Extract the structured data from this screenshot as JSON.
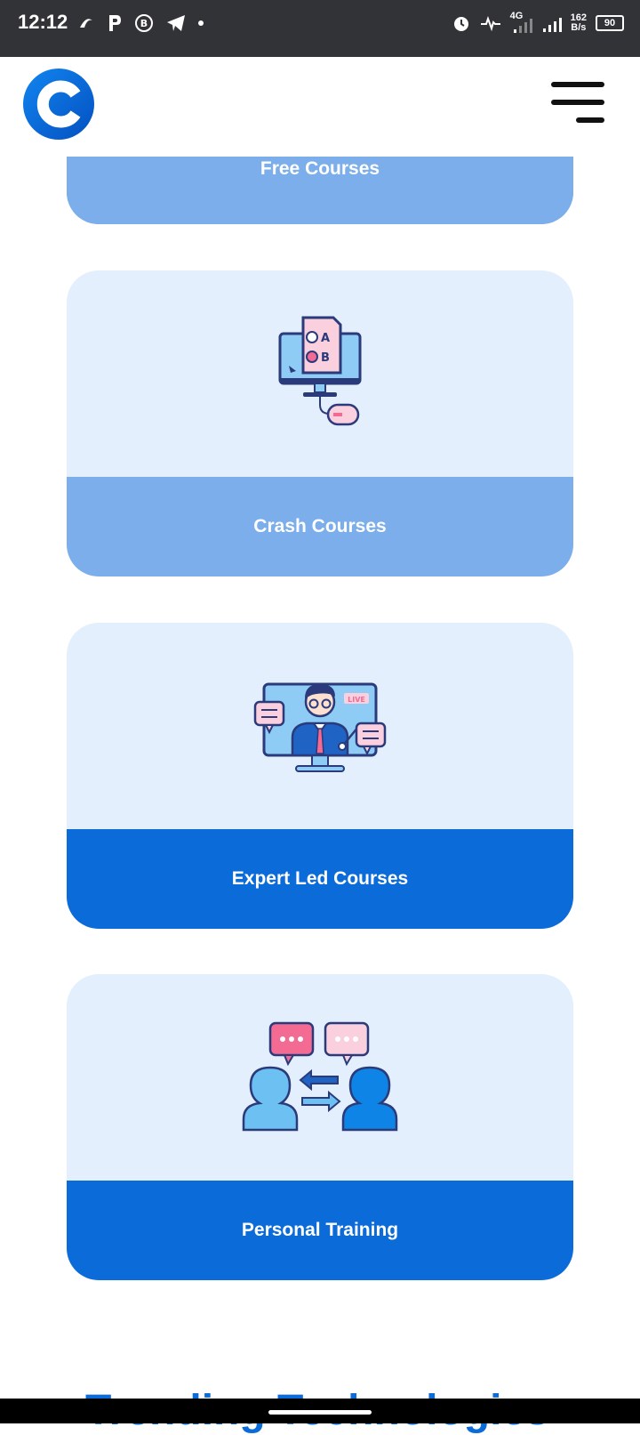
{
  "status_bar": {
    "time": "12:12",
    "network_type": "4G",
    "net_speed_value": "162",
    "net_speed_unit": "B/s",
    "battery": "90"
  },
  "header": {
    "logo_icon": "brand-c-logo",
    "menu_icon": "hamburger-menu-icon"
  },
  "cards": [
    {
      "label": "Free Courses",
      "icon": "free-courses-icon"
    },
    {
      "label": "Crash Courses",
      "icon": "quiz-computer-icon"
    },
    {
      "label": "Expert Led Courses",
      "icon": "live-instructor-icon"
    },
    {
      "label": "Personal Training",
      "icon": "conversation-icon"
    }
  ],
  "colors": {
    "primary": "#0b6bd9",
    "light_label": "#7baeea",
    "card_bg": "#e3effc"
  },
  "partial_heading": "Trending Technologies"
}
